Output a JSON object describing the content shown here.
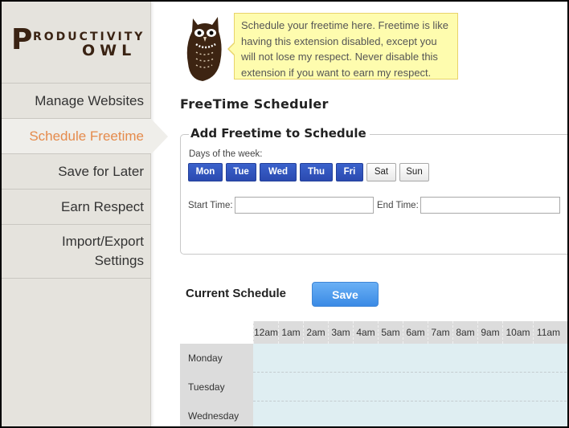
{
  "logo": {
    "big_letter": "P",
    "top_text": "RODUCTIVITY",
    "bottom_text": "OWL"
  },
  "sidebar": {
    "items": [
      {
        "label": "Manage Websites",
        "active": false
      },
      {
        "label": "Schedule Freetime",
        "active": true
      },
      {
        "label": "Save for Later",
        "active": false
      },
      {
        "label": "Earn Respect",
        "active": false
      },
      {
        "label_line1": "Import/Export",
        "label_line2": "Settings",
        "active": false
      }
    ]
  },
  "owl_bubble": "Schedule your freetime here. Freetime is like having this extension disabled, except you will not lose my respect. Never disable this extension if you want to earn my respect.",
  "page_title": "FreeTime Scheduler",
  "add_form": {
    "legend": "Add Freetime to Schedule",
    "days_label": "Days of the week:",
    "days": [
      {
        "label": "Mon",
        "selected": true
      },
      {
        "label": "Tue",
        "selected": true
      },
      {
        "label": "Wed",
        "selected": true
      },
      {
        "label": "Thu",
        "selected": true
      },
      {
        "label": "Fri",
        "selected": true
      },
      {
        "label": "Sat",
        "selected": false
      },
      {
        "label": "Sun",
        "selected": false
      }
    ],
    "start_label": "Start Time:",
    "start_value": "",
    "end_label": "End Time:",
    "end_value": ""
  },
  "schedule": {
    "title": "Current Schedule",
    "save_label": "Save",
    "hours": [
      "12am",
      "1am",
      "2am",
      "3am",
      "4am",
      "5am",
      "6am",
      "7am",
      "8am",
      "9am",
      "10am",
      "11am"
    ],
    "rows": [
      "Monday",
      "Tuesday",
      "Wednesday"
    ]
  },
  "colors": {
    "active_nav": "#e58b4c",
    "day_selected": "#2f51bb",
    "save_button": "#4a98ec",
    "bubble_bg": "#fefcae",
    "grid_bg": "#dfeef2"
  }
}
